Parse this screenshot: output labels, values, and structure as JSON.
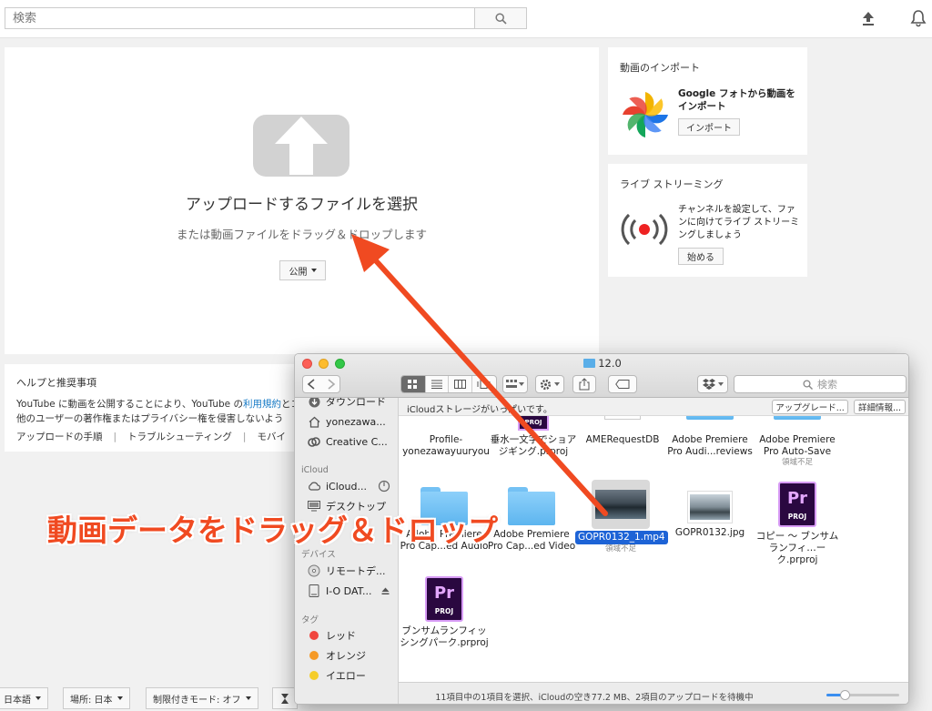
{
  "search": {
    "placeholder": "検索"
  },
  "upload": {
    "title": "アップロードするファイルを選択",
    "subtitle": "または動画ファイルをドラッグ＆ドロップします",
    "privacy_label": "公開"
  },
  "import_card": {
    "title": "動画のインポート",
    "desc": "Google フォトから動画をインポート",
    "button": "インポート"
  },
  "live_card": {
    "title": "ライブ ストリーミング",
    "desc": "チャンネルを設定して、ファンに向けてライブ ストリーミングしましょう",
    "button": "始める"
  },
  "help": {
    "title": "ヘルプと推奨事項",
    "line1_pre": "YouTube に動画を公開することにより、YouTube の",
    "line1_link": "利用規約",
    "line1_post": "とコ",
    "line2": "他のユーザーの著作権またはプライバシー権を侵害しないよう",
    "links": [
      "アップロードの手順",
      "トラブルシューティング",
      "モバイ"
    ]
  },
  "footer": {
    "language": "日本語",
    "location": "場所: 日本",
    "restricted": "制限付きモード: オフ"
  },
  "finder": {
    "window_title": "12.0",
    "search_placeholder": "検索",
    "sidebar": {
      "favorites": [
        "ダウンロード",
        "yonezawa...",
        "Creative C..."
      ],
      "icloud_head": "iCloud",
      "icloud": [
        "iCloud...",
        "デスクトップ"
      ],
      "devices_head": "デバイス",
      "devices": [
        "リモートデ...",
        "I-O DAT..."
      ],
      "tags_head": "タグ",
      "tags": [
        {
          "name": "レッド",
          "color": "#f0463f"
        },
        {
          "name": "オレンジ",
          "color": "#f59a27"
        },
        {
          "name": "イエロー",
          "color": "#f5cd2b"
        }
      ]
    },
    "icloud_bar": {
      "text": "iCloudストレージがいっぱいです。",
      "upgrade": "アップグレード...",
      "details": "詳細情報..."
    },
    "files": [
      {
        "name": "Profile-\nyonezawayuuryou"
      },
      {
        "name": "垂水一文字でショア\nジギング.prproj"
      },
      {
        "name": "AMERequestDB"
      },
      {
        "name": "Adobe Premiere\nPro Audi...reviews"
      },
      {
        "name": "Adobe Premiere\nPro Auto-Save",
        "note": "領域不足"
      },
      {
        "name": "Adobe Premiere\nPro Cap...ed Audio"
      },
      {
        "name": "Adobe Premiere\nPro Cap...ed Video"
      },
      {
        "name": "GOPR0132_1.mp4",
        "note": "領域不足"
      },
      {
        "name": "GOPR0132.jpg"
      },
      {
        "name": "コピー ～ ブンサム\nランフィ…ーク.prproj"
      },
      {
        "name": "ブンサムランフィッ\nシングパーク.prproj"
      }
    ],
    "status": "11項目中の1項目を選択、iCloudの空き77.2 MB、2項目のアップロードを待機中",
    "zoom_level": 0.25
  },
  "annotation": "動画データをドラッグ＆ドロップ"
}
